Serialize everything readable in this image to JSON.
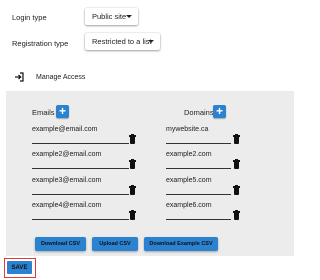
{
  "login": {
    "label": "Login type",
    "value": "Public site"
  },
  "registration": {
    "label": "Registration type",
    "value": "Restricted to a list"
  },
  "manage_access": {
    "label": "Manage Access"
  },
  "emails": {
    "title": "Emails",
    "add_label": "+",
    "items": [
      "example@email.com",
      "example2@email.com",
      "example3@email.com",
      "example4@email.com"
    ]
  },
  "domains": {
    "title": "Domains",
    "add_label": "+",
    "items": [
      "mywebsite.ca",
      "example2.com",
      "example5.com",
      "example6.com"
    ]
  },
  "actions": {
    "download_csv": "Download CSV",
    "upload_csv": "Upload CSV",
    "download_example_csv": "Download Example CSV"
  },
  "save": {
    "label": "SAVE"
  },
  "colors": {
    "primary": "#2a82d0",
    "panel": "#ececec",
    "highlight": "#e53935"
  }
}
